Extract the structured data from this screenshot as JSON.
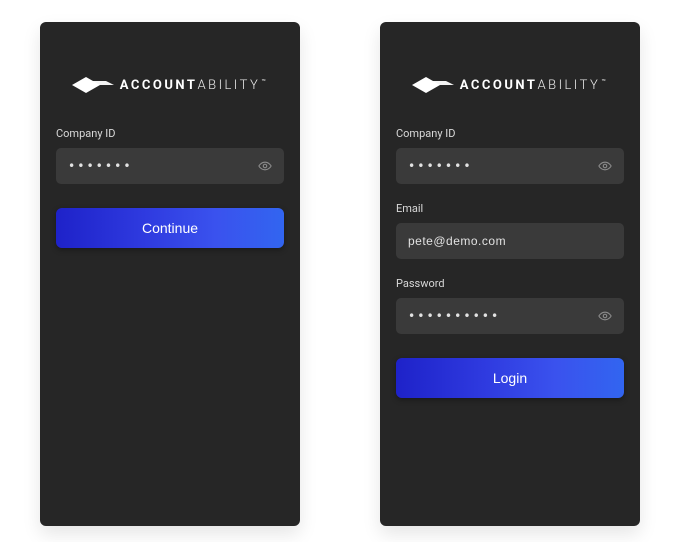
{
  "brand": {
    "word1": "ACCOUNT",
    "word2": "ABILITY",
    "trademark": "™"
  },
  "colors": {
    "panel_bg": "#262626",
    "input_bg": "#3a3a3a",
    "button_gradient_start": "#1e22c9",
    "button_gradient_end": "#3265f0"
  },
  "left_screen": {
    "company_id": {
      "label": "Company ID",
      "value_masked": "•••••••"
    },
    "continue_button": "Continue"
  },
  "right_screen": {
    "company_id": {
      "label": "Company ID",
      "value_masked": "•••••••"
    },
    "email": {
      "label": "Email",
      "value": "pete@demo.com"
    },
    "password": {
      "label": "Password",
      "value_masked": "••••••••••"
    },
    "login_button": "Login"
  }
}
